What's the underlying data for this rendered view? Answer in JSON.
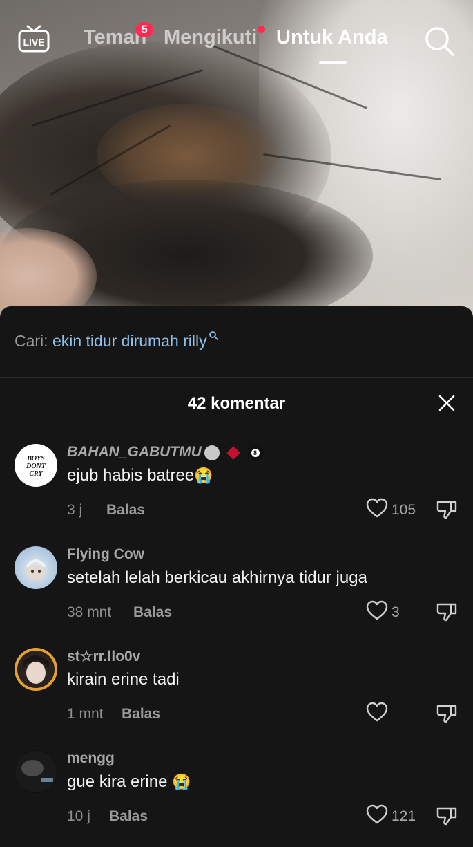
{
  "nav": {
    "tabs": [
      {
        "label": "Teman",
        "badge": "5"
      },
      {
        "label": "Mengikuti"
      },
      {
        "label": "Untuk Anda"
      }
    ],
    "active_tab": "Untuk Anda",
    "live_label": "LIVE"
  },
  "search": {
    "label": "Cari:",
    "query": "ekin tidur dirumah rilly"
  },
  "comments_header": {
    "count_label": "42 komentar"
  },
  "comments": [
    {
      "username": "BAHAN_GABUTMU",
      "text": "ejub habis batree",
      "emoji": "😭",
      "time": "3 j",
      "reply": "Balas",
      "likes": "105",
      "avatar_text": "BOYS DONT CRY"
    },
    {
      "username": "Flying Cow",
      "text": "setelah lelah berkicau akhirnya tidur juga",
      "emoji": "",
      "time": "38 mnt",
      "reply": "Balas",
      "likes": "3"
    },
    {
      "username": "st☆rr.llo0v",
      "text": "kirain erine tadi",
      "emoji": "",
      "time": "1 mnt",
      "reply": "Balas",
      "likes": ""
    },
    {
      "username": "mengg",
      "text": "gue kira erine ",
      "emoji": "😭",
      "time": "10 j",
      "reply": "Balas",
      "likes": "121"
    }
  ],
  "colors": {
    "accent": "#fe2c55",
    "search_query": "#8fc1ea",
    "sheet_bg": "#151515"
  }
}
